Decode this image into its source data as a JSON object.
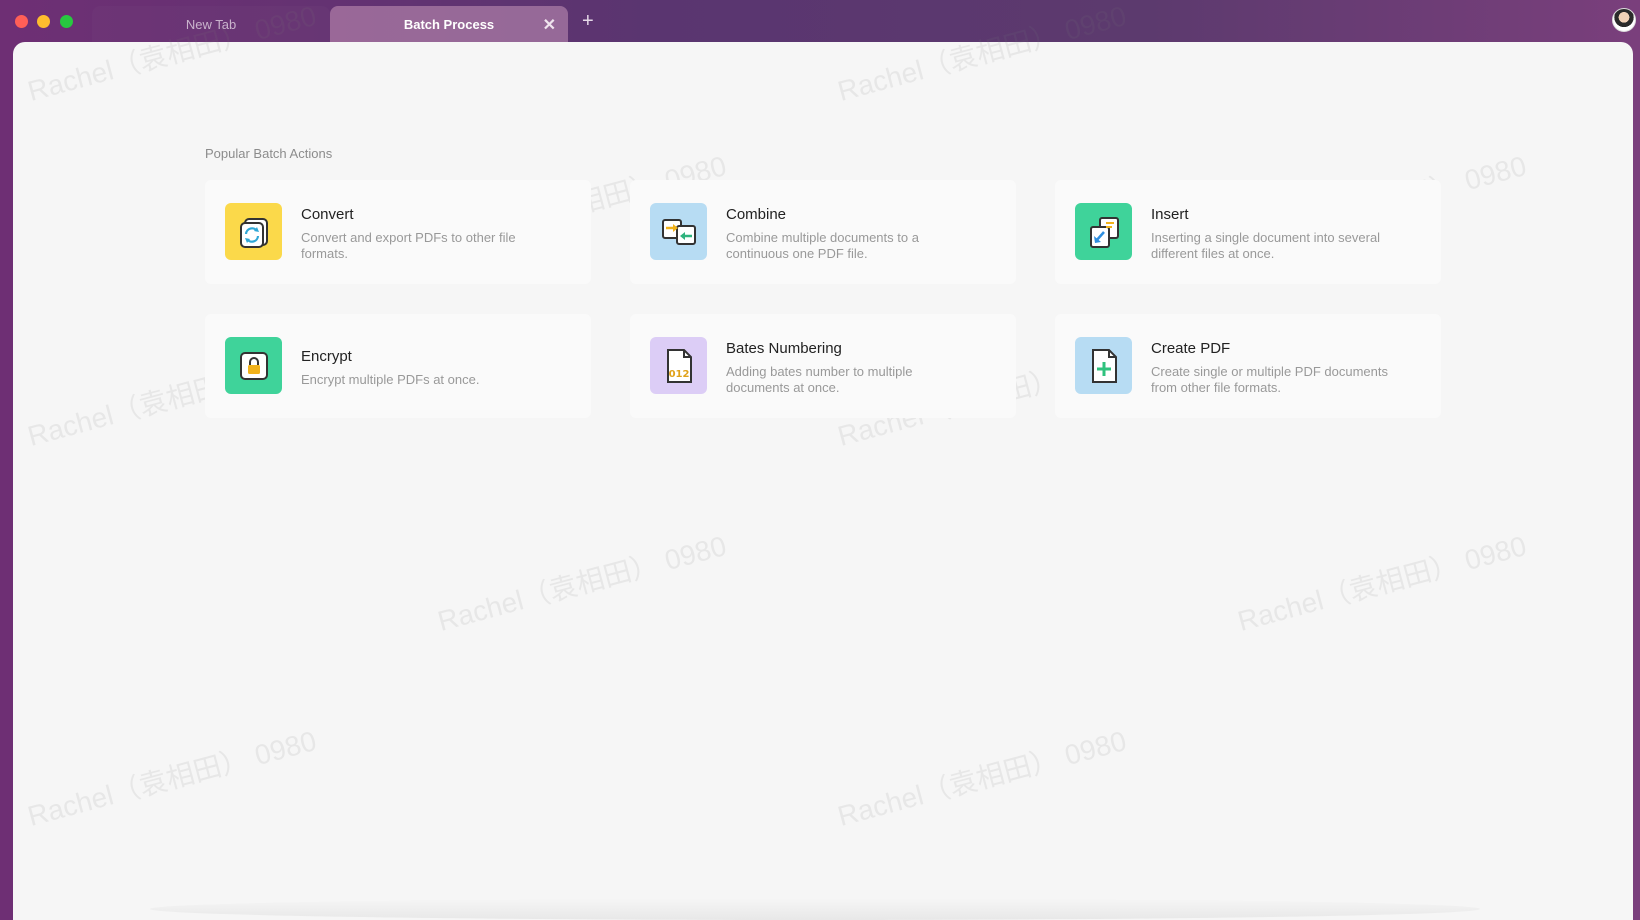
{
  "tabs": {
    "new_tab": "New Tab",
    "active": "Batch Process",
    "close_glyph": "✕",
    "add_glyph": "+"
  },
  "section_title": "Popular Batch Actions",
  "actions": [
    {
      "title": "Convert",
      "desc": "Convert and export PDFs to other file formats.",
      "icon": "convert-icon",
      "color": "#fbd94a"
    },
    {
      "title": "Combine",
      "desc": "Combine multiple documents to a continuous one PDF file.",
      "icon": "combine-icon",
      "color": "#b7dcf3"
    },
    {
      "title": "Insert",
      "desc": "Inserting a single document into several different files at once.",
      "icon": "insert-icon",
      "color": "#3fd39a"
    },
    {
      "title": "Encrypt",
      "desc": "Encrypt multiple PDFs at once.",
      "icon": "lock-icon",
      "color": "#3fd39a"
    },
    {
      "title": "Bates Numbering",
      "desc": "Adding bates number to multiple documents at once.",
      "icon": "bates-number-icon",
      "color": "#dccdf6"
    },
    {
      "title": "Create PDF",
      "desc": "Create single or multiple PDF documents from other file formats.",
      "icon": "create-pdf-icon",
      "color": "#b7dcf3"
    }
  ],
  "bates_icon_text": "012",
  "watermark_text": "Rachel（袁相田） 0980"
}
